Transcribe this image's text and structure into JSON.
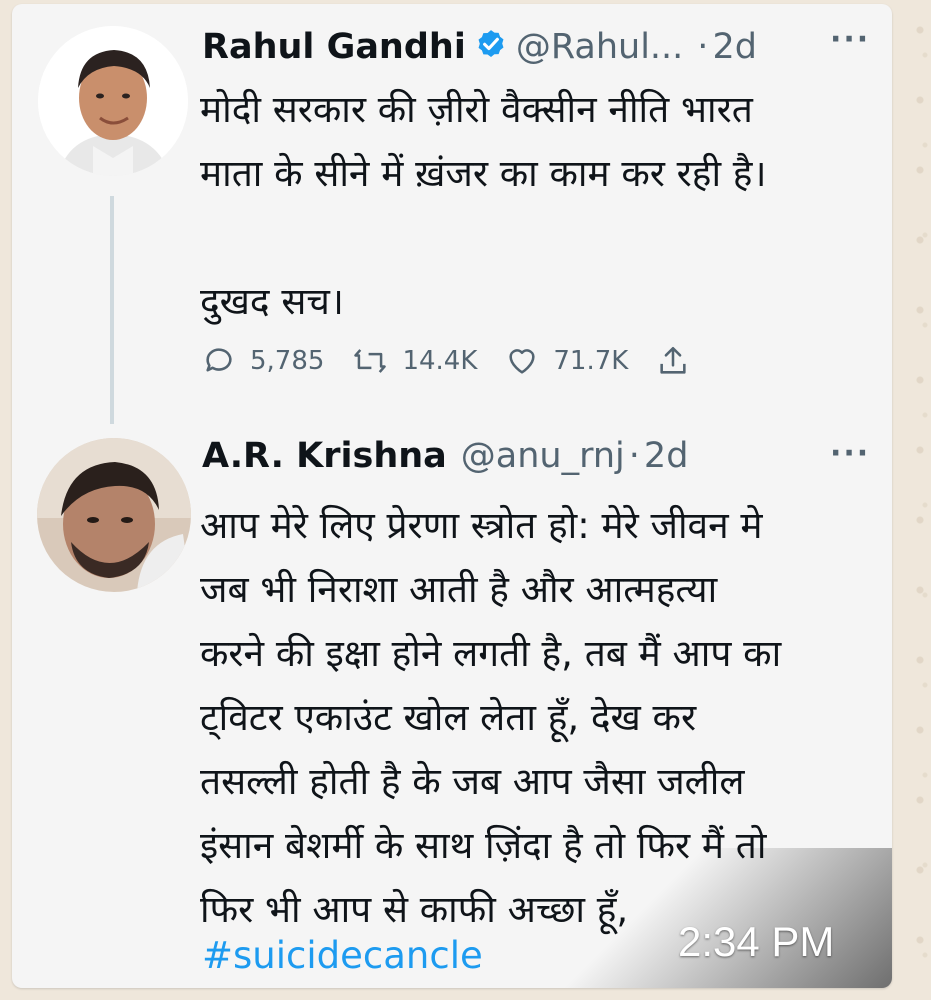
{
  "message": {
    "timestamp": "2:34 PM"
  },
  "tweets": [
    {
      "name": "Rahul Gandhi",
      "handle": "@Rahul...",
      "separator": "·",
      "time": "2d",
      "more": "···",
      "text": "मोदी सरकार की ज़ीरो वैक्सीन नीति भारत\nमाता के सीने में ख़ंजर का काम कर रही है।\n\nदुखद सच।",
      "replies": "5,785",
      "retweets": "14.4K",
      "likes": "71.7K",
      "verified_color": "#1d9bf0"
    },
    {
      "name": "A.R. Krishna",
      "handle": "@anu_rnj",
      "separator": "·",
      "time": "2d",
      "more": "···",
      "text": "आप मेरे लिए प्रेरणा स्त्रोत हो: मेरे जीवन मे\nजब भी निराशा आती है और आत्महत्या\nकरने की इक्षा होने लगती है, तब मैं आप का\nट्विटर एकाउंट खोल लेता हूँ, देख कर\nतसल्ली होती है के जब आप जैसा जलील\nइंसान बेशर्मी के साथ ज़िंदा है तो फिर मैं तो\nफिर भी आप से काफी अच्छा हूँ,",
      "hashtag": "#suicidecancle"
    }
  ],
  "icons": {
    "reply": "reply-icon",
    "retweet": "retweet-icon",
    "like": "heart-icon",
    "share": "share-icon",
    "verified": "verified-badge-icon"
  }
}
